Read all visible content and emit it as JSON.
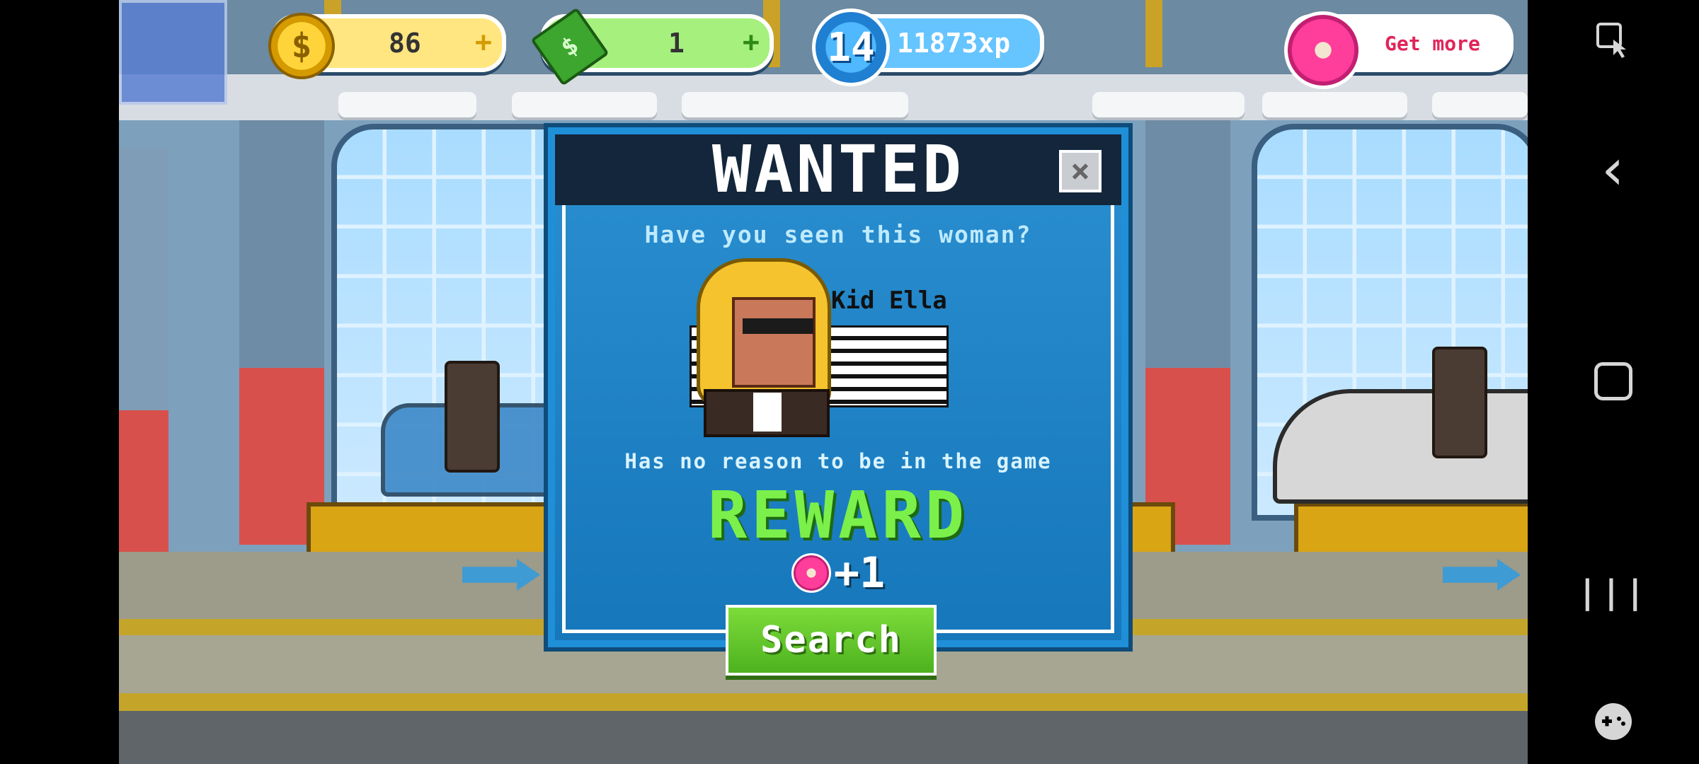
{
  "hud": {
    "coins": "86",
    "cash": "1",
    "level": "14",
    "xp": "11873xp",
    "get_more": "Get more",
    "plus": "+"
  },
  "dialog": {
    "title": "WANTED",
    "close": "×",
    "question": "Have you seen this woman?",
    "suspect_name": "Kid Ella",
    "description": "Has no reason to be in the game",
    "reward_label": "REWARD",
    "reward_amount": "+1",
    "search_label": "Search"
  },
  "colors": {
    "dialog_blue": "#1677bb",
    "reward_green": "#7cf04a",
    "donut_pink": "#ff3d9a",
    "coin_gold": "#ffd43b"
  },
  "icons": {
    "coin": "$",
    "cash": "$"
  },
  "navbar": {
    "back": "‹",
    "recents": "|||"
  }
}
